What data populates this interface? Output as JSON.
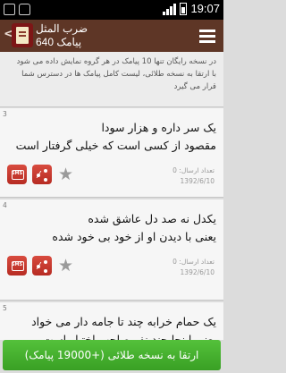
{
  "status_bar": {
    "time": "19:07",
    "left_icons": [
      "photo-notification-icon",
      "shopping-bag-icon"
    ],
    "right_icons": [
      "signal-icon",
      "battery-icon"
    ]
  },
  "app_bar": {
    "back_glyph": "<",
    "title": "ضرب المثل",
    "subtitle": "640 پیامک",
    "menu_icon": "hamburger-menu-icon"
  },
  "banner": {
    "text": "در نسخه رایگان تنها 10 پیامک در هر گروه نمایش داده می شود با ارتقا به نسخه طلائی، لیست کامل پیامک ها در دسترس شما قرار می گیرد"
  },
  "cards": [
    {
      "number": "3",
      "lines": [
        "یک سر داره و هزار سودا",
        "مقصود از کسی است که خیلی گرفتار است"
      ],
      "sent_count_label": "تعداد ارسال: 0",
      "date": "1392/6/10",
      "sms_label": "SMS"
    },
    {
      "number": "4",
      "lines": [
        "یکدل نه صد دل عاشق شده",
        "یعنی با دیدن او از خود بی خود شده"
      ],
      "sent_count_label": "تعداد ارسال: 0",
      "date": "1392/6/10",
      "sms_label": "SMS"
    },
    {
      "number": "5",
      "lines": [
        "یک حمام خرابه چند تا جامه دار می خواد",
        "یعنی اینجا چند نفر صاحب اختیار است"
      ],
      "sent_count_label": "",
      "date": "",
      "sms_label": "SMS"
    }
  ],
  "upgrade_button": {
    "label": "ارتقا به نسخه طلائی (+19000 پیامک)"
  },
  "colors": {
    "app_bar": "#5e3626",
    "action_button": "#c63a30",
    "upgrade_button": "#46b22e"
  }
}
